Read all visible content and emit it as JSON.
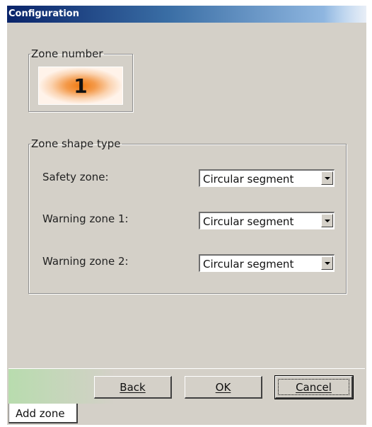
{
  "window": {
    "title": "Configuration"
  },
  "zone_number": {
    "legend": "Zone number",
    "value": "1"
  },
  "zone_shape": {
    "legend": "Zone shape type",
    "rows": [
      {
        "label": "Safety zone:",
        "value": "Circular segment"
      },
      {
        "label": "Warning zone 1:",
        "value": "Circular segment"
      },
      {
        "label": "Warning zone 2:",
        "value": "Circular segment"
      }
    ]
  },
  "buttons": {
    "back": "Back",
    "ok": "OK",
    "cancel": "Cancel"
  },
  "tab": {
    "label": "Add zone"
  }
}
